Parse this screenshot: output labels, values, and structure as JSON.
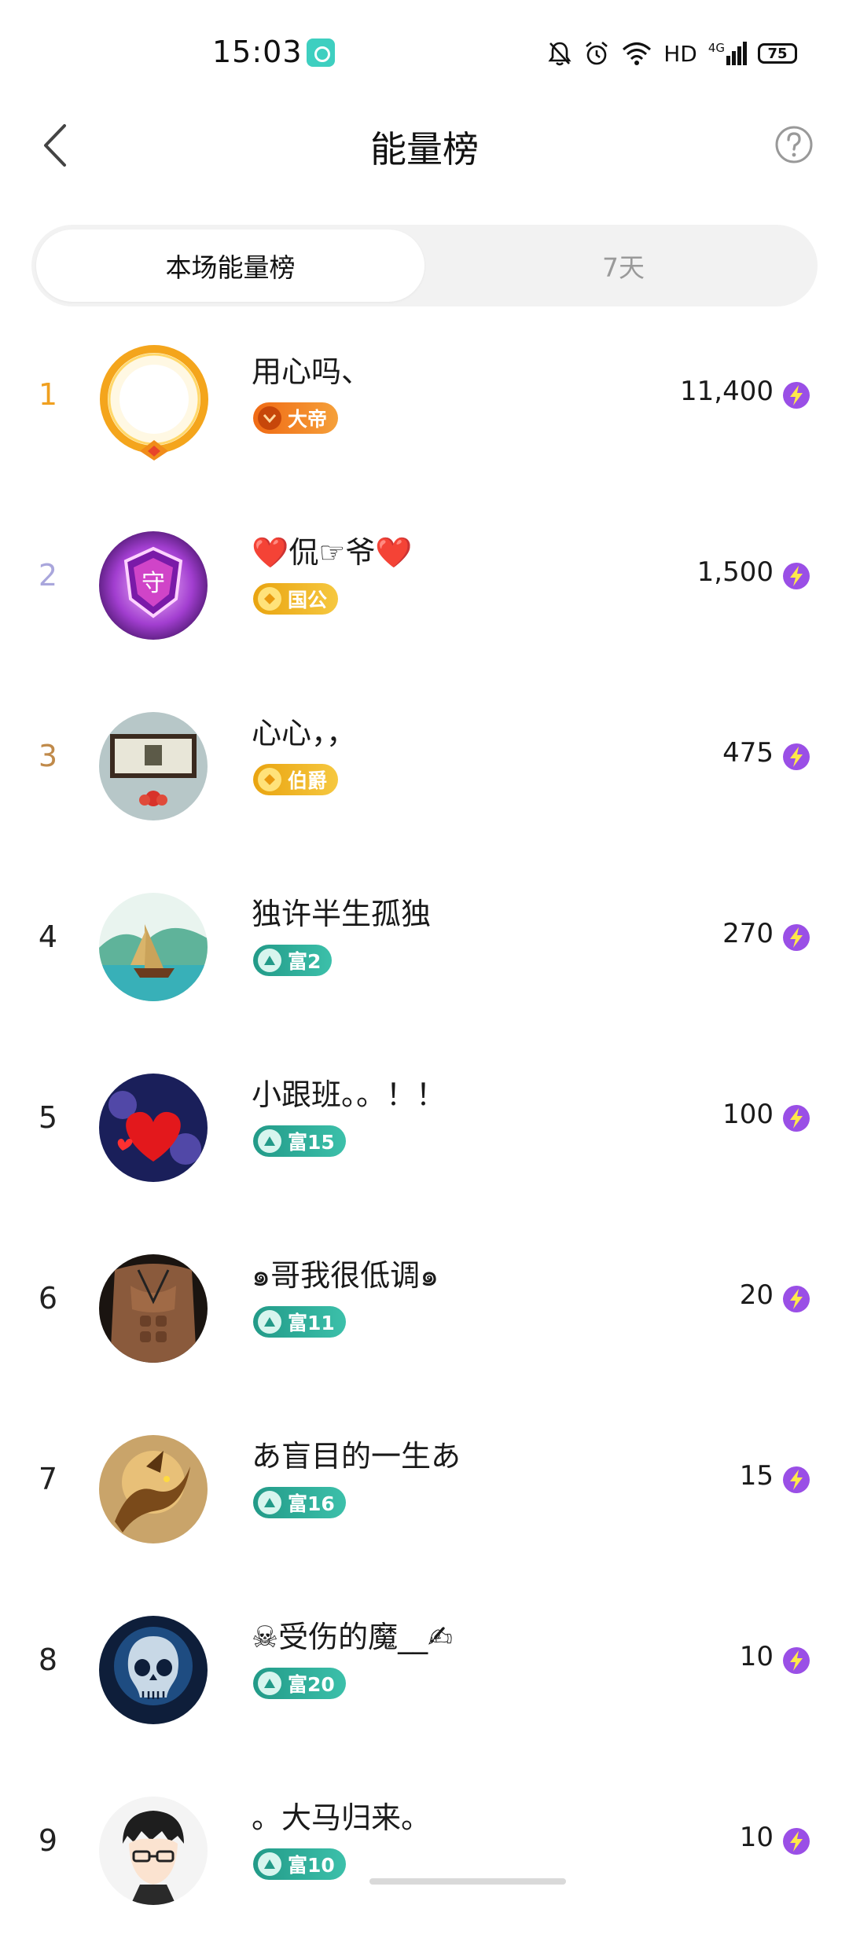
{
  "status": {
    "time": "15:03",
    "network_label": "HD",
    "network_type": "4G",
    "battery": "75"
  },
  "header": {
    "title": "能量榜"
  },
  "tabs": [
    {
      "label": "本场能量榜",
      "active": true
    },
    {
      "label": "7天",
      "active": false
    }
  ],
  "colors": {
    "rank_1": "#f0a020",
    "rank_2": "#a9a6dc",
    "rank_3": "#c08a4a",
    "badge_noble_orange": "#f07a1e",
    "badge_noble_gold": "#f2b320",
    "badge_wealth_teal": "#2fae9a",
    "bolt_purple": "#9a4fe6"
  },
  "rows": [
    {
      "rank": "1",
      "name": "用心吗、",
      "badge": "大帝",
      "score": "11,400"
    },
    {
      "rank": "2",
      "name": "❤️侃☞爷❤️",
      "badge": "国公",
      "score": "1,500"
    },
    {
      "rank": "3",
      "name": "心心，，",
      "badge": "伯爵",
      "score": "475"
    },
    {
      "rank": "4",
      "name": "独许半生孤独",
      "badge": "富2",
      "score": "270"
    },
    {
      "rank": "5",
      "name": "小跟班。。！！",
      "badge": "富15",
      "score": "100"
    },
    {
      "rank": "6",
      "name": "๑哥我很低调๑",
      "badge": "富11",
      "score": "20"
    },
    {
      "rank": "7",
      "name": "あ盲目的一生あ",
      "badge": "富16",
      "score": "15"
    },
    {
      "rank": "8",
      "name": "☠受伤的魔__✍",
      "badge": "富20",
      "score": "10"
    },
    {
      "rank": "9",
      "name": "。大马归来。",
      "badge": "富10",
      "score": "10"
    }
  ]
}
